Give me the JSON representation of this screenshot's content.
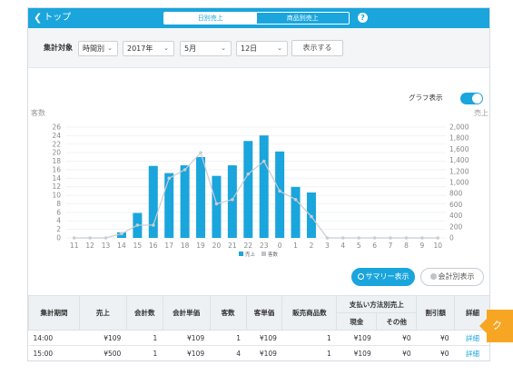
{
  "header": {
    "back_label": "トップ",
    "tabs": [
      {
        "label": "日別売上",
        "active": false
      },
      {
        "label": "商品別売上",
        "active": true
      }
    ],
    "help_glyph": "?",
    "accent_color": "#1aa5dc"
  },
  "filters": {
    "label": "集計対象",
    "selects": [
      {
        "value": "時間別"
      },
      {
        "value": "2017年"
      },
      {
        "value": "5月"
      },
      {
        "value": "12日"
      }
    ],
    "submit_label": "表示する"
  },
  "graph_toggle": {
    "label": "グラフ表示",
    "on": true
  },
  "chart_data": {
    "type": "bar",
    "categories": [
      "11",
      "12",
      "13",
      "14",
      "15",
      "16",
      "17",
      "18",
      "19",
      "20",
      "21",
      "22",
      "23",
      "0",
      "1",
      "2",
      "3",
      "4",
      "5",
      "6",
      "7",
      "8",
      "9",
      "10"
    ],
    "series": [
      {
        "name": "売上",
        "axis": "right",
        "kind": "bar",
        "color": "#1aa5dc",
        "values": [
          0,
          0,
          0,
          100,
          450,
          1300,
          1170,
          1310,
          1460,
          1120,
          1310,
          1750,
          1850,
          1560,
          920,
          820,
          0,
          0,
          0,
          0,
          0,
          0,
          0,
          0
        ]
      },
      {
        "name": "客数",
        "axis": "left",
        "kind": "line",
        "color": "#c8cdd2",
        "values": [
          0,
          0,
          0,
          1,
          3,
          3,
          14,
          16,
          20,
          8,
          9,
          15,
          18,
          11,
          9,
          5,
          0,
          0,
          0,
          0,
          0,
          0,
          0,
          0
        ]
      }
    ],
    "y_left": {
      "label": "客数",
      "ticks": [
        "26",
        "24",
        "22",
        "20",
        "18",
        "16",
        "14",
        "12",
        "10",
        "8",
        "6",
        "4",
        "2",
        "0"
      ],
      "ylim": [
        0,
        26
      ]
    },
    "y_right": {
      "label": "売上",
      "ticks": [
        "2,000",
        "1,800",
        "1,600",
        "1,400",
        "1,200",
        "1,000",
        "800",
        "600",
        "400",
        "200",
        "0"
      ],
      "ylim": [
        0,
        2000
      ]
    },
    "legend": [
      "売上",
      "客数"
    ],
    "grid": true
  },
  "view_buttons": {
    "summary": "サマリー表示",
    "by_account": "会計別表示"
  },
  "table": {
    "headers": [
      "集計期間",
      "売上",
      "会計数",
      "会計単価",
      "客数",
      "客単価",
      "販売商品数",
      "支払い方法別売上",
      "割引額",
      "詳細"
    ],
    "payment_sub": [
      "現金",
      "その他"
    ],
    "rows": [
      [
        "14:00",
        "¥109",
        "1",
        "¥109",
        "1",
        "¥109",
        "1",
        "¥109",
        "¥0",
        "¥0",
        "詳細"
      ],
      [
        "15:00",
        "¥500",
        "1",
        "¥109",
        "4",
        "¥109",
        "1",
        "¥109",
        "¥0",
        "¥0",
        "詳細"
      ]
    ]
  },
  "callout": {
    "text": "ク"
  }
}
